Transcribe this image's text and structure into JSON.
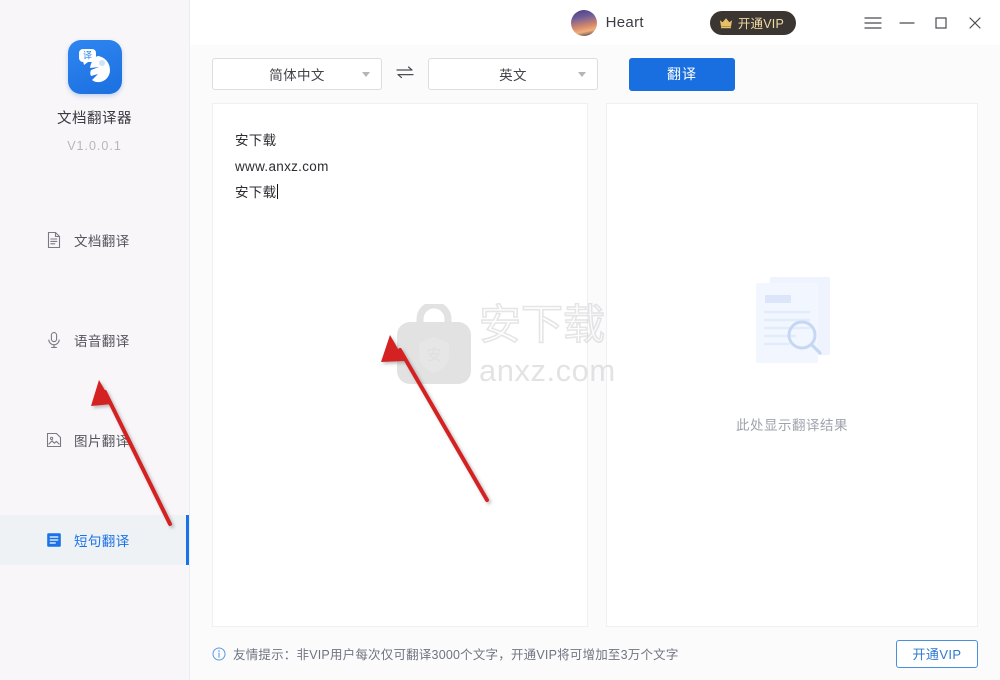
{
  "sidebar": {
    "brand_name": "文档翻译器",
    "version": "V1.0.0.1",
    "items": [
      {
        "label": "文档翻译",
        "icon": "document-icon",
        "active": false
      },
      {
        "label": "语音翻译",
        "icon": "microphone-icon",
        "active": false
      },
      {
        "label": "图片翻译",
        "icon": "image-icon",
        "active": false
      },
      {
        "label": "短句翻译",
        "icon": "text-lines-icon",
        "active": true
      }
    ]
  },
  "header": {
    "username": "Heart",
    "vip_label": "开通VIP",
    "avatar": "user-avatar",
    "menu_icon": "hamburger-menu-icon",
    "minimize_icon": "minimize-icon",
    "maximize_icon": "maximize-icon",
    "close_icon": "close-icon"
  },
  "toolbar": {
    "source_language": "简体中文",
    "target_language": "英文",
    "swap_icon": "swap-arrows-icon",
    "translate_label": "翻译"
  },
  "editor": {
    "line1": "安下载",
    "line2": "www.anxz.com",
    "line3": "安下载"
  },
  "result": {
    "placeholder": "此处显示翻译结果",
    "illustration": "document-search-illustration"
  },
  "statusbar": {
    "info_icon": "info-circle-icon",
    "tip": "友情提示：非VIP用户每次仅可翻译3000个文字，开通VIP将可增加至3万个文字",
    "vip_button": "开通VIP"
  },
  "watermark": {
    "text": "安下载",
    "domain": "anxz.com",
    "icon": "shield-bag-icon"
  },
  "colors": {
    "accent": "#1a6fe0",
    "active_text": "#1a72e8",
    "vip_pill_bg": "#3b3631",
    "vip_pill_text": "#f2d9a8",
    "annotation_red": "#d42020"
  }
}
